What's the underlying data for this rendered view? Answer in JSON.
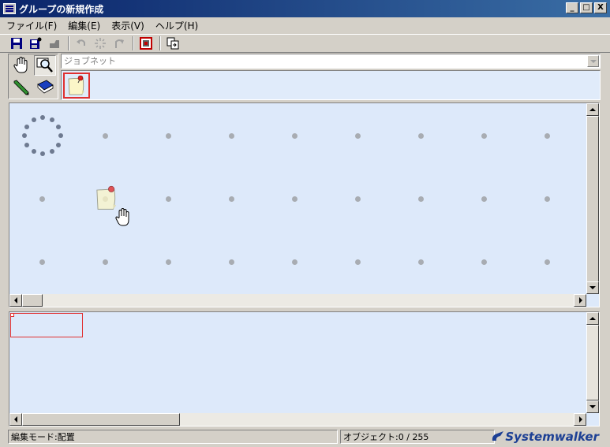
{
  "window": {
    "title": "グループの新規作成",
    "controls": {
      "minimize": "_",
      "maximize": "□",
      "close": "X"
    }
  },
  "menu": {
    "items": [
      {
        "label": "ファイル(F)"
      },
      {
        "label": "編集(E)"
      },
      {
        "label": "表示(V)"
      },
      {
        "label": "ヘルプ(H)"
      }
    ]
  },
  "toolbar": {
    "buttons": [
      {
        "icon": "save-icon",
        "enabled": true
      },
      {
        "icon": "save-as-icon",
        "enabled": true
      },
      {
        "icon": "stamp-icon",
        "enabled": false
      },
      {
        "icon": "undo-icon",
        "enabled": false
      },
      {
        "icon": "sparkle-icon",
        "enabled": false
      },
      {
        "icon": "redo-icon",
        "enabled": false
      },
      {
        "icon": "properties-icon",
        "enabled": true
      },
      {
        "icon": "copy-icon",
        "enabled": true
      }
    ]
  },
  "palette": {
    "tools": [
      {
        "icon": "hand-icon",
        "selected": false
      },
      {
        "icon": "magnifier-icon",
        "selected": true
      },
      {
        "icon": "pencil-icon",
        "selected": false
      },
      {
        "icon": "book-icon",
        "selected": false
      }
    ]
  },
  "combo": {
    "value": "ジョブネット"
  },
  "icon_strip": {
    "items": [
      {
        "icon": "pinned-note-icon",
        "selected": true
      }
    ]
  },
  "status": {
    "mode": "編集モード:配置",
    "objects": "オブジェクト:0 / 255",
    "logo": "Systemwalker"
  },
  "colors": {
    "canvas": "#dde9fa",
    "selection": "#e03030",
    "title_gradient_start": "#0a246a",
    "logo": "#1c3f94"
  }
}
